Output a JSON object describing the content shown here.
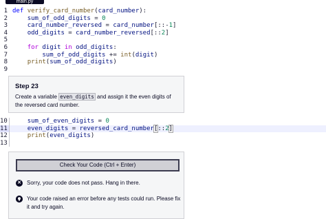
{
  "tab": {
    "label": "main.py"
  },
  "editor_top": {
    "line_numbers": [
      "1",
      "2",
      "3",
      "4",
      "5",
      "6",
      "7",
      "8",
      "9"
    ],
    "lines": [
      "def verify_card_number(card_number):",
      "    sum_of_odd_digits = 0",
      "    card_number_reversed = card_number[::-1]",
      "    odd_digits = card_number_reversed[::2]",
      "",
      "    for digit in odd_digits:",
      "        sum_of_odd_digits += int(digit)",
      "    print(sum_of_odd_digits)",
      ""
    ]
  },
  "step": {
    "title": "Step 23",
    "desc_before": "Create a variable ",
    "desc_code": "even_digits",
    "desc_after": " and assign it the even digits of the reversed card number."
  },
  "editor_bottom": {
    "line_numbers": [
      "10",
      "11",
      "12",
      "13"
    ],
    "lines": [
      "    sum_of_even_digits = 0",
      "    even_digits = reversed_card_number[::2]",
      "    print(even_digits)",
      ""
    ]
  },
  "actions": {
    "check_button": "Check Your Code (Ctrl + Enter)",
    "fail_message": "Sorry, your code does not pass. Hang in there.",
    "hint_message": "Your code raised an error before any tests could run. Please fix it and try again."
  }
}
